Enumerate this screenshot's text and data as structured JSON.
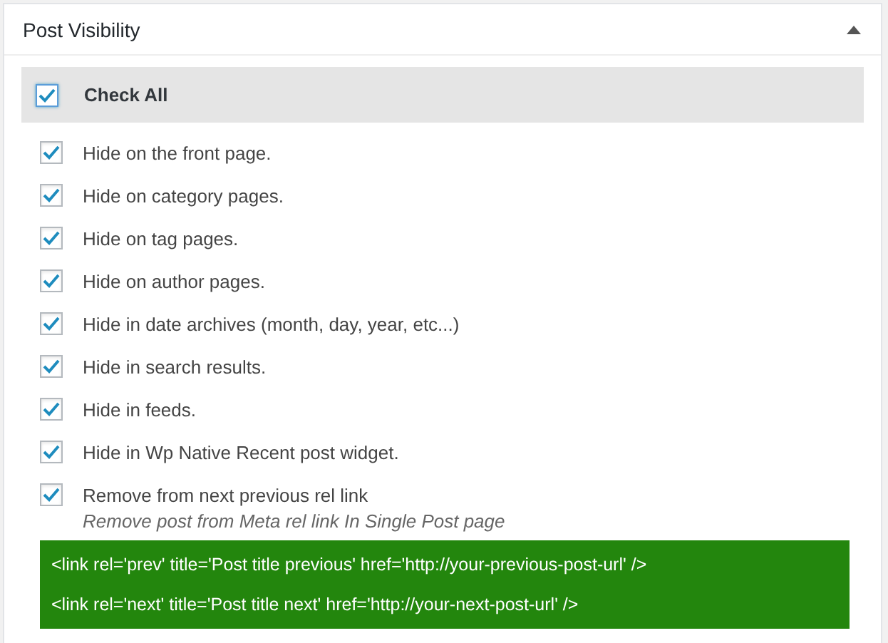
{
  "panel": {
    "title": "Post Visibility",
    "expanded": true
  },
  "check_all": {
    "label": "Check All",
    "checked": true
  },
  "options": [
    {
      "label": "Hide on the front page.",
      "checked": true
    },
    {
      "label": "Hide on category pages.",
      "checked": true
    },
    {
      "label": "Hide on tag pages.",
      "checked": true
    },
    {
      "label": "Hide on author pages.",
      "checked": true
    },
    {
      "label": "Hide in date archives (month, day, year, etc...)",
      "checked": true
    },
    {
      "label": "Hide in search results.",
      "checked": true
    },
    {
      "label": "Hide in feeds.",
      "checked": true
    },
    {
      "label": "Hide in Wp Native Recent post widget.",
      "checked": true
    },
    {
      "label": "Remove from next previous rel link",
      "checked": true,
      "description": "Remove post from Meta rel link In Single Post page"
    }
  ],
  "code_lines": [
    "<link rel='prev' title='Post title previous' href='http://your-previous-post-url' />",
    "<link rel='next' title='Post title next' href='http://your-next-post-url' />"
  ]
}
